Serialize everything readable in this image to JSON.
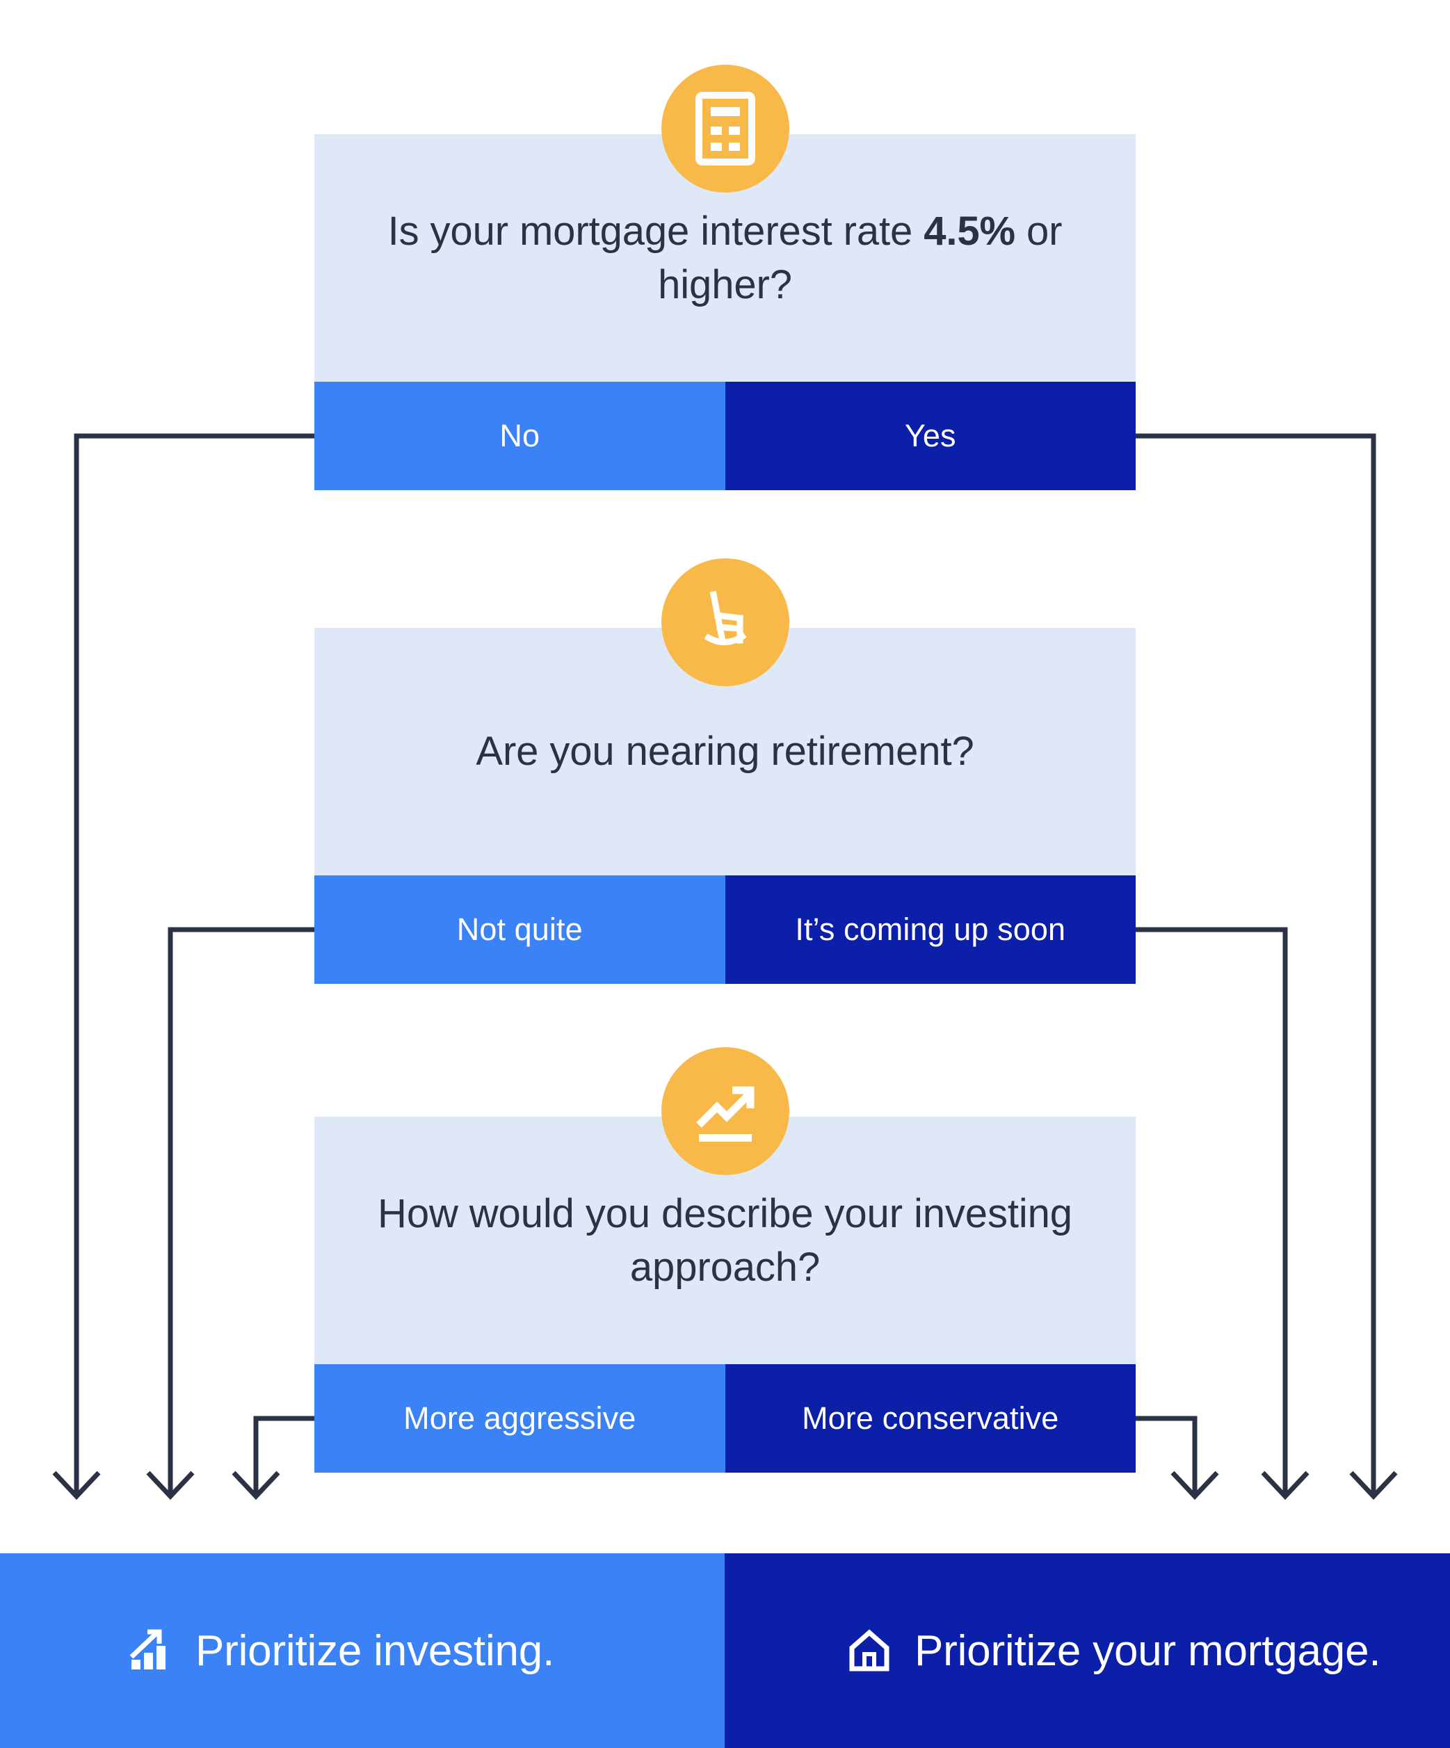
{
  "palette": {
    "page_background": "#ffffff",
    "card_background": "#dfe8f7",
    "answer_light_blue": "#3b82f6",
    "answer_dark_blue": "#0b1fa8",
    "badge_amber": "#f9b949",
    "question_text": "#2b3245",
    "connector_line": "#2b3245"
  },
  "steps": [
    {
      "id": "step-1",
      "icon": "calculator-icon",
      "question_prefix": "Is your mortgage interest rate ",
      "question_emphasis": "4.5%",
      "question_suffix": " or higher?",
      "question_plain": "Is your mortgage interest rate 4.5% or higher?",
      "answer_left": "No",
      "answer_right": "Yes"
    },
    {
      "id": "step-2",
      "icon": "rocking-chair-icon",
      "question_plain": "Are you nearing retirement?",
      "answer_left": "Not quite",
      "answer_right": "It’s coming up soon"
    },
    {
      "id": "step-3",
      "icon": "trending-up-icon",
      "question_plain": "How would you describe your investing approach?",
      "answer_left": "More aggressive",
      "answer_right": "More conservative"
    }
  ],
  "results": {
    "left": {
      "icon": "bar-chart-growth-icon",
      "label": "Prioritize investing."
    },
    "right": {
      "icon": "home-icon",
      "label": "Prioritize your mortgage."
    }
  },
  "flow": {
    "description": "Three-question decision tree; every light-blue answer routes to Prioritize investing, every dark-blue answer routes to Prioritize your mortgage.",
    "edges": [
      {
        "from": "step-1",
        "answer": "No",
        "to": "result-left"
      },
      {
        "from": "step-1",
        "answer": "Yes",
        "to": "result-right"
      },
      {
        "from": "step-2",
        "answer": "Not quite",
        "to": "result-left"
      },
      {
        "from": "step-2",
        "answer": "It’s coming up soon",
        "to": "result-right"
      },
      {
        "from": "step-3",
        "answer": "More aggressive",
        "to": "result-left"
      },
      {
        "from": "step-3",
        "answer": "More conservative",
        "to": "result-right"
      }
    ]
  }
}
